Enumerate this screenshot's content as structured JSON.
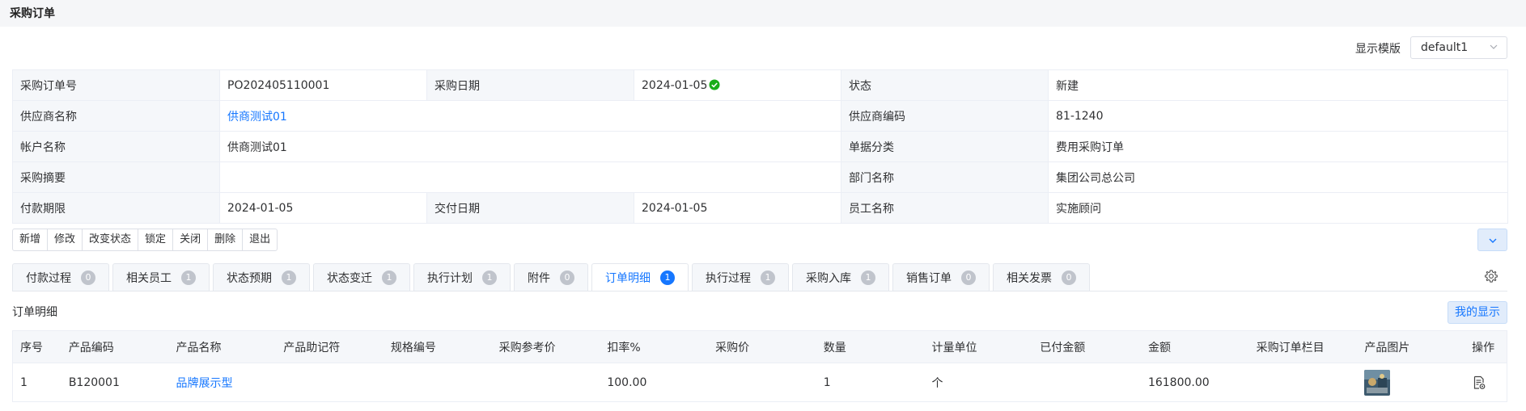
{
  "page": {
    "title": "采购订单"
  },
  "template": {
    "label": "显示模版",
    "value": "default1"
  },
  "info": {
    "order_no": {
      "label": "采购订单号",
      "value": "PO202405110001"
    },
    "order_date": {
      "label": "采购日期",
      "value": "2024-01-05"
    },
    "status": {
      "label": "状态",
      "value": "新建"
    },
    "supplier_name": {
      "label": "供应商名称",
      "value": "供商测试01"
    },
    "supplier_code": {
      "label": "供应商编码",
      "value": "81-1240"
    },
    "account_name": {
      "label": "帐户名称",
      "value": "供商测试01"
    },
    "doc_category": {
      "label": "单据分类",
      "value": "费用采购订单"
    },
    "summary": {
      "label": "采购摘要",
      "value": ""
    },
    "department": {
      "label": "部门名称",
      "value": "集团公司总公司"
    },
    "payment_deadline": {
      "label": "付款期限",
      "value": "2024-01-05"
    },
    "delivery_date": {
      "label": "交付日期",
      "value": "2024-01-05"
    },
    "employee": {
      "label": "员工名称",
      "value": "实施顾问"
    }
  },
  "toolbar": {
    "new": "新增",
    "edit": "修改",
    "change_status": "改变状态",
    "lock": "锁定",
    "close": "关闭",
    "delete": "删除",
    "exit": "退出"
  },
  "tabs": [
    {
      "label": "付款过程",
      "count": "0"
    },
    {
      "label": "相关员工",
      "count": "1"
    },
    {
      "label": "状态预期",
      "count": "1"
    },
    {
      "label": "状态变迁",
      "count": "1"
    },
    {
      "label": "执行计划",
      "count": "1"
    },
    {
      "label": "附件",
      "count": "0"
    },
    {
      "label": "订单明细",
      "count": "1",
      "active": true
    },
    {
      "label": "执行过程",
      "count": "1"
    },
    {
      "label": "采购入库",
      "count": "1"
    },
    {
      "label": "销售订单",
      "count": "0"
    },
    {
      "label": "相关发票",
      "count": "0"
    }
  ],
  "detail": {
    "title": "订单明细",
    "my_display": "我的显示",
    "columns": [
      "序号",
      "产品编码",
      "产品名称",
      "产品助记符",
      "规格编号",
      "采购参考价",
      "扣率%",
      "采购价",
      "数量",
      "计量单位",
      "已付金额",
      "金额",
      "采购订单栏目",
      "产品图片",
      "操作"
    ],
    "rows": [
      {
        "seq": "1",
        "code": "B120001",
        "name": "品牌展示型",
        "mnemonic": "",
        "spec": "",
        "ref_price": "",
        "discount": "100.00",
        "price": "",
        "qty": "1",
        "unit": "个",
        "paid": "",
        "amount": "161800.00",
        "column": ""
      }
    ]
  },
  "colors": {
    "accent": "#1677ff",
    "success": "#1aad19",
    "badge_inactive": "#c0c4cc",
    "label_bg": "#f5f7fa"
  },
  "icons": {
    "date_check": "check-circle-icon",
    "collapse": "chevron-down-icon",
    "settings": "gear-icon",
    "operation": "document-view-icon",
    "product_image": "product-thumbnail"
  }
}
